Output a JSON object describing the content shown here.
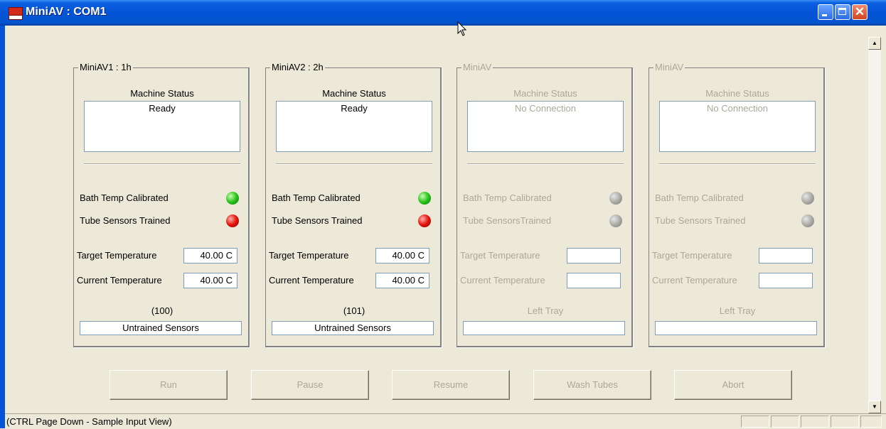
{
  "window": {
    "title": "MiniAV : COM1",
    "close_glyph": "✕"
  },
  "panels": [
    {
      "legend": "MiniAV1 : 1h",
      "machine_status_label": "Machine Status",
      "status": "Ready",
      "bath_label": "Bath Temp Calibrated",
      "bath_led": "green",
      "tube_label": "Tube Sensors Trained",
      "tube_led": "red",
      "target_label": "Target Temperature",
      "target_value": "40.00 C",
      "current_label": "Current Temperature",
      "current_value": "40.00 C",
      "count": "(100)",
      "bottom_text": "Untrained Sensors"
    },
    {
      "legend": "MiniAV2 : 2h",
      "machine_status_label": "Machine Status",
      "status": "Ready",
      "bath_label": "Bath Temp Calibrated",
      "bath_led": "green",
      "tube_label": "Tube Sensors Trained",
      "tube_led": "red",
      "target_label": "Target Temperature",
      "target_value": "40.00 C",
      "current_label": "Current Temperature",
      "current_value": "40.00 C",
      "count": "(101)",
      "bottom_text": "Untrained Sensors"
    },
    {
      "legend": "MiniAV",
      "machine_status_label": "Machine Status",
      "status": "No Connection",
      "bath_label": "Bath Temp Calibrated",
      "bath_led": "grey",
      "tube_label": "Tube SensorsTrained",
      "tube_led": "grey",
      "target_label": "Target Temperature",
      "target_value": "",
      "current_label": "Current Temperature",
      "current_value": "",
      "count": "Left Tray",
      "bottom_text": ""
    },
    {
      "legend": "MiniAV",
      "machine_status_label": "Machine Status",
      "status": "No Connection",
      "bath_label": "Bath Temp Calibrated",
      "bath_led": "grey",
      "tube_label": "Tube Sensors Trained",
      "tube_led": "grey",
      "target_label": "Target Temperature",
      "target_value": "",
      "current_label": "Current Temperature",
      "current_value": "",
      "count": "Left Tray",
      "bottom_text": ""
    }
  ],
  "buttons": {
    "run": "Run",
    "pause": "Pause",
    "resume": "Resume",
    "wash": "Wash Tubes",
    "abort": "Abort"
  },
  "statusbar": {
    "text": "(CTRL Page Down - Sample Input View)"
  },
  "colors": {
    "led_green": "#29c21a",
    "led_red": "#e3140c",
    "led_grey": "#a7a6a1",
    "title_bar": "#0553d7"
  }
}
